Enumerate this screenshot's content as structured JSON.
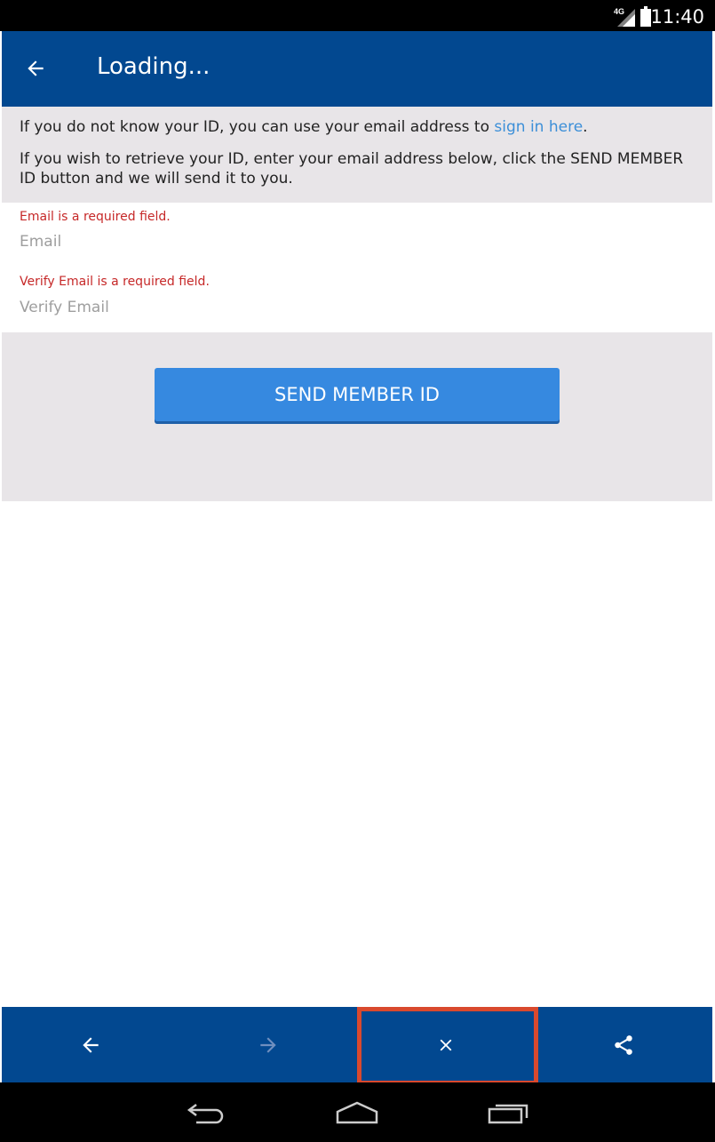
{
  "status_bar": {
    "network_type": "4G",
    "time": "11:40"
  },
  "app_bar": {
    "title": "Loading..."
  },
  "info": {
    "line1_prefix": "If you do not know your ID, you can use your email address to ",
    "line1_link": "sign in here",
    "line1_suffix": ".",
    "line2": "If you wish to retrieve your ID, enter your email address below, click the SEND MEMBER ID button and we will send it to you."
  },
  "form": {
    "email_error": "Email is a required field.",
    "email_placeholder": "Email",
    "email_value": "",
    "verify_error": "Verify Email is a required field.",
    "verify_placeholder": "Verify Email",
    "verify_value": ""
  },
  "actions": {
    "send_label": "SEND MEMBER ID"
  },
  "toolbar": {
    "items": [
      {
        "icon": "arrow-left-icon",
        "enabled": true
      },
      {
        "icon": "arrow-right-icon",
        "enabled": false
      },
      {
        "icon": "close-icon",
        "enabled": true,
        "highlighted": true
      },
      {
        "icon": "share-icon",
        "enabled": true
      }
    ]
  },
  "colors": {
    "primary": "#024890",
    "button": "#3689e0",
    "error": "#c62828",
    "link": "#3c8fd8",
    "panel": "#e8e5e8",
    "highlight": "#d9492e"
  }
}
